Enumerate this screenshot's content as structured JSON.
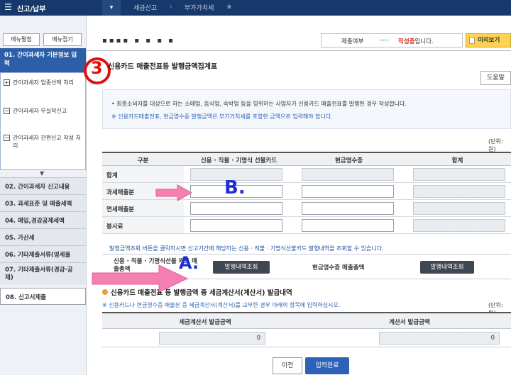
{
  "topbar": {
    "menu_icon": "menu-icon",
    "title": "신고/납부",
    "crumb1": "세금신고",
    "crumb2": "부가가치세",
    "star_icon": "star-icon"
  },
  "sidebar": {
    "expand_all": "메뉴펼침",
    "collapse_all": "메뉴접기",
    "active_item": "01. 간이과세자 기본정보 입력",
    "sub_items": [
      "간이과세자 업종선택 처리",
      "간이과세자 무실적신고",
      "간이과세자 간편신고 작성 처리"
    ],
    "items": [
      "02. 간이과세자 신고내용",
      "03. 과세표준 및 매출세액",
      "04. 매입,경감공제세액",
      "05. 가산세",
      "06. 기타제출서류(영세율",
      "07. 기타제출서류(경감·공제)",
      "08. 신고서제출"
    ]
  },
  "header": {
    "blurred_text": "▪▪▪▪ ▪ ▪ ▪ ▪",
    "submit_label": "제출여부",
    "submit_arrows": "››››",
    "status_prefix": "작성중",
    "status_suffix": "입니다.",
    "preview_button": "미리보기"
  },
  "section1": {
    "step_number": "3",
    "title": "신용카드 매출전표등 발행금액집계표",
    "help_button": "도움말",
    "info_line1": "• 최종소비자를 대상으로 하는 소매업, 음식업, 숙박업 등을 영위하는 사업자가 신용카드 매출전표를 발행한 경우 작성합니다.",
    "info_line2": "※ 신용카드매출전표, 현금영수증 발행금액은 부가가치세를 포함한 금액으로 입력해야 합니다.",
    "unit_label": "(단위: 원)",
    "columns": [
      "구분",
      "신용 · 직불 · 기명식 선불카드",
      "현금영수증",
      "합계"
    ],
    "rows": [
      "합계",
      "과세매출분",
      "면세매출분",
      "봉사료"
    ]
  },
  "inquiry": {
    "note": "발행금액조회 버튼을 클릭하시면 신고기간에 해당하는 신용 · 직불 · 기명식선불카드 발행내역을 조회할 수 있습니다.",
    "card_label": "신용 · 직불 · 기명식선불 카드 매출총액",
    "card_button": "발행내역조회",
    "cash_label": "현금영수증 매출총액",
    "cash_button": "발행내역조회"
  },
  "section2": {
    "title": "신용카드 매출전표 등 발행금액 중 세금계산서(계산서) 발급내역",
    "note": "※ 신용카드나 현금영수증 매출분 중 세금계산서(계산서)를 교부한 경우 아래의 항목에 입력하십시오.",
    "unit_label": "(단위: 원)",
    "columns": [
      "세금계산서 발급금액",
      "계산서 발급금액"
    ],
    "values": [
      "0",
      "0"
    ]
  },
  "footer": {
    "prev_button": "이전",
    "done_button": "입력완료"
  },
  "annotations": {
    "label_a": "A.",
    "label_b": "B.",
    "arrow_color": "#f47fb0",
    "label_color": "#1c2fd6",
    "circle_color": "#e01010"
  }
}
